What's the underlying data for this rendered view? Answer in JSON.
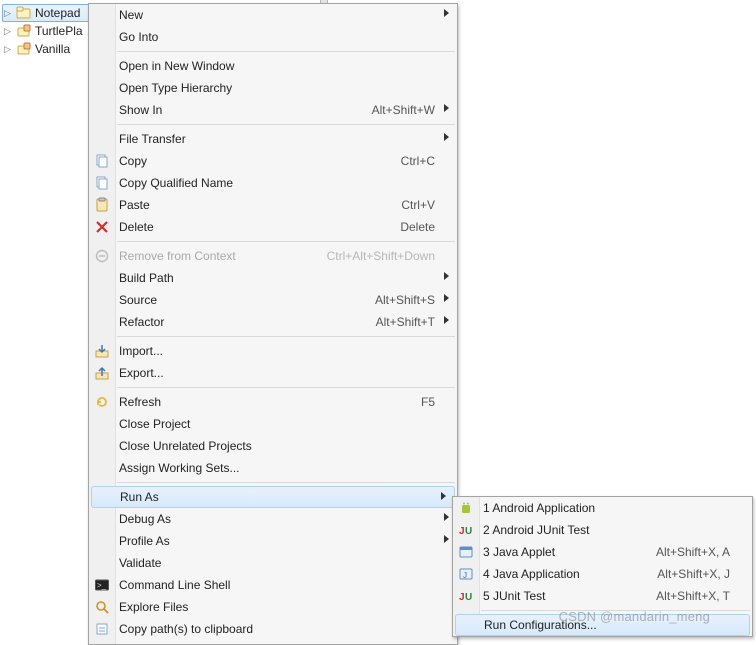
{
  "tree": {
    "items": [
      {
        "label": "Notepad",
        "selected": true,
        "icon": "folder-open-icon"
      },
      {
        "label": "TurtlePla",
        "selected": false,
        "icon": "plugin-project-icon"
      },
      {
        "label": "Vanilla",
        "selected": false,
        "icon": "plugin-project-icon"
      }
    ]
  },
  "menu": {
    "groups": [
      [
        {
          "label": "New",
          "submenu": true
        },
        {
          "label": "Go Into"
        }
      ],
      [
        {
          "label": "Open in New Window"
        },
        {
          "label": "Open Type Hierarchy"
        },
        {
          "label": "Show In",
          "accel": "Alt+Shift+W",
          "submenu": true
        }
      ],
      [
        {
          "label": "File Transfer",
          "submenu": true
        },
        {
          "label": "Copy",
          "accel": "Ctrl+C",
          "icon": "copy-icon"
        },
        {
          "label": "Copy Qualified Name",
          "icon": "copy-qname-icon"
        },
        {
          "label": "Paste",
          "accel": "Ctrl+V",
          "icon": "paste-icon"
        },
        {
          "label": "Delete",
          "accel": "Delete",
          "icon": "delete-icon"
        }
      ],
      [
        {
          "label": "Remove from Context",
          "accel": "Ctrl+Alt+Shift+Down",
          "disabled": true,
          "icon": "remove-context-icon"
        },
        {
          "label": "Build Path",
          "submenu": true
        },
        {
          "label": "Source",
          "accel": "Alt+Shift+S",
          "submenu": true
        },
        {
          "label": "Refactor",
          "accel": "Alt+Shift+T",
          "submenu": true
        }
      ],
      [
        {
          "label": "Import...",
          "icon": "import-icon"
        },
        {
          "label": "Export...",
          "icon": "export-icon"
        }
      ],
      [
        {
          "label": "Refresh",
          "accel": "F5",
          "icon": "refresh-icon"
        },
        {
          "label": "Close Project"
        },
        {
          "label": "Close Unrelated Projects"
        },
        {
          "label": "Assign Working Sets..."
        }
      ],
      [
        {
          "label": "Run As",
          "submenu": true,
          "highlight": true
        },
        {
          "label": "Debug As",
          "submenu": true
        },
        {
          "label": "Profile As",
          "submenu": true
        },
        {
          "label": "Validate"
        },
        {
          "label": "Command Line Shell",
          "icon": "shell-icon"
        },
        {
          "label": "Explore Files",
          "icon": "explore-icon"
        },
        {
          "label": "Copy path(s) to clipboard",
          "icon": "copy-path-icon"
        }
      ]
    ]
  },
  "submenu": {
    "groups": [
      [
        {
          "label": "1 Android Application",
          "icon": "android-icon"
        },
        {
          "label": "2 Android JUnit Test",
          "icon": "junit-icon"
        },
        {
          "label": "3 Java Applet",
          "accel": "Alt+Shift+X, A",
          "icon": "applet-icon"
        },
        {
          "label": "4 Java Application",
          "accel": "Alt+Shift+X, J",
          "icon": "java-app-icon"
        },
        {
          "label": "5 JUnit Test",
          "accel": "Alt+Shift+X, T",
          "icon": "junit-icon"
        }
      ],
      [
        {
          "label": "Run Configurations...",
          "highlight": true
        }
      ]
    ]
  },
  "watermark": "CSDN @mandarin_meng"
}
